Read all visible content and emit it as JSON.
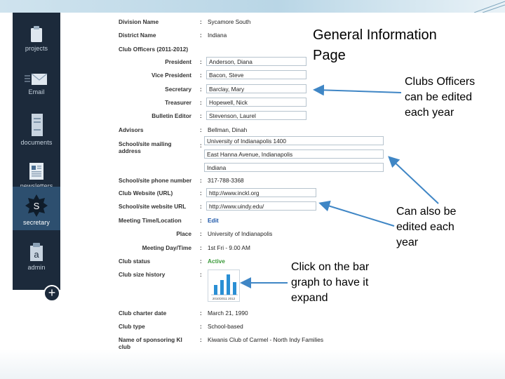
{
  "sidebar": {
    "items": [
      {
        "label": "projects",
        "icon": "clipboard-icon"
      },
      {
        "label": "Email",
        "icon": "envelope-icon"
      },
      {
        "label": "documents",
        "icon": "document-icon"
      },
      {
        "label": "newsletters",
        "icon": "newsletter-icon"
      },
      {
        "label": "secretary",
        "icon": "s-star-icon",
        "badge": "S"
      },
      {
        "label": "admin",
        "icon": "admin-icon",
        "badge": "a"
      }
    ],
    "add_symbol": "+"
  },
  "form": {
    "division_name": {
      "label": "Division Name",
      "value": "Sycamore South"
    },
    "district_name": {
      "label": "District Name",
      "value": "Indiana"
    },
    "club_officers": {
      "label": "Club Officers (2011-2012)"
    },
    "officers": [
      {
        "role": "President",
        "name": "Anderson, Diana"
      },
      {
        "role": "Vice President",
        "name": "Bacon, Steve"
      },
      {
        "role": "Secretary",
        "name": "Barclay, Mary"
      },
      {
        "role": "Treasurer",
        "name": "Hopewell, Nick"
      },
      {
        "role": "Bulletin Editor",
        "name": "Stevenson, Laurel"
      }
    ],
    "advisors": {
      "label": "Advisors",
      "value": "Bellman, Dinah"
    },
    "mailing": {
      "label_line1": "School/site mailing",
      "label_line2": "address",
      "line1": "University of Indianapolis 1400",
      "line2": "East Hanna Avenue, Indianapolis",
      "line3": "Indiana"
    },
    "phone": {
      "label": "School/site phone number",
      "value": "317-788-3368"
    },
    "club_website": {
      "label": "Club Website (URL)",
      "value": "http://www.inckl.org"
    },
    "site_website": {
      "label": "School/site website URL",
      "value": "http://www.uindy.edu/"
    },
    "meeting_time": {
      "label": "Meeting Time/Location",
      "value": "Edit"
    },
    "place": {
      "label": "Place",
      "value": "University of Indianapolis"
    },
    "meeting_day": {
      "label": "Meeting Day/Time",
      "value": "1st Fri - 9.00 AM"
    },
    "club_status": {
      "label": "Club status",
      "value": "Active"
    },
    "size_history": {
      "label": "Club size history",
      "caption": "2010/2011 2012"
    },
    "charter_date": {
      "label": "Club charter date",
      "value": "March 21, 1990"
    },
    "club_type": {
      "label": "Club type",
      "value": "School-based"
    },
    "sponsor": {
      "label_line1": "Name of sponsoring KI",
      "label_line2": "club",
      "value": "Kiwanis Club of Carmel - North Indy Families"
    },
    "colon": ":"
  },
  "annotations": {
    "title_line1": "General Information",
    "title_line2": "Page",
    "officers_note": [
      "Clubs Officers",
      "can be edited",
      "each year"
    ],
    "edit_note": [
      "Can also be",
      "edited each",
      "year"
    ],
    "graph_note": [
      "Click on the bar",
      "graph to have it",
      "expand"
    ]
  },
  "colors": {
    "sidebar": "#1c2a3b",
    "sidebar_active": "#2d4f6f",
    "arrow": "#3f86c5",
    "link": "#1a55a8",
    "status_active": "#3a9a3a",
    "chart_bar": "#2a8fd4"
  }
}
